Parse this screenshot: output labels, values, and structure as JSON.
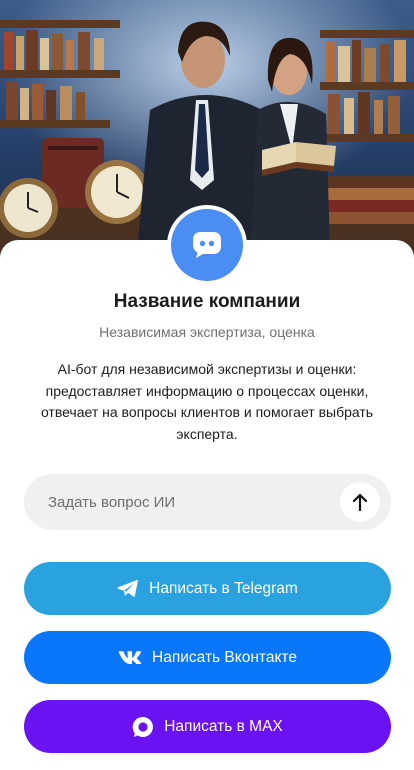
{
  "company": {
    "name": "Название компании",
    "category": "Независимая экспертиза, оценка",
    "description": "AI-бот для независимой экспертизы и оценки: предоставляет информацию о процессах оценки, отвечает на вопросы клиентов и помогает выбрать эксперта.",
    "avatar_icon": "chat-bubble-icon"
  },
  "ask": {
    "placeholder": "Задать вопрос ИИ",
    "send_icon": "arrow-up-icon"
  },
  "buttons": {
    "telegram": {
      "label": "Написать в Telegram",
      "icon": "telegram-icon",
      "color": "#2aa2e0"
    },
    "vk": {
      "label": "Написать Вконтакте",
      "icon": "vk-icon",
      "color": "#0a77fb"
    },
    "max": {
      "label": "Написать в MAX",
      "icon": "max-icon",
      "color": "#6b12f2"
    }
  },
  "colors": {
    "accent": "#4b8ef3",
    "input_background": "#f0f0f1"
  }
}
